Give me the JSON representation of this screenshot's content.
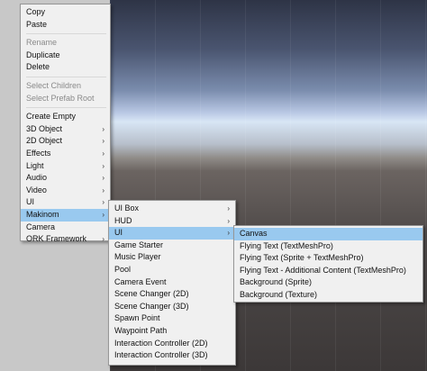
{
  "main_menu": {
    "copy": "Copy",
    "paste": "Paste",
    "rename": "Rename",
    "duplicate": "Duplicate",
    "delete": "Delete",
    "select_children": "Select Children",
    "select_prefab_root": "Select Prefab Root",
    "create_empty": "Create Empty",
    "object_3d": "3D Object",
    "object_2d": "2D Object",
    "effects": "Effects",
    "light": "Light",
    "audio": "Audio",
    "video": "Video",
    "ui": "UI",
    "makinom": "Makinom",
    "camera": "Camera",
    "ork_framework": "ORK Framework",
    "submenu_arrow": "›"
  },
  "makinom_menu": {
    "items": [
      "UI Box",
      "HUD",
      "UI",
      "Game Starter",
      "Music Player",
      "Pool",
      "Camera Event",
      "Scene Changer (2D)",
      "Scene Changer (3D)",
      "Spawn Point",
      "Waypoint Path",
      "Interaction Controller (2D)",
      "Interaction Controller (3D)"
    ]
  },
  "ui_menu": {
    "items": [
      "Canvas",
      "Flying Text (TextMeshPro)",
      "Flying Text (Sprite + TextMeshPro)",
      "Flying Text - Additional Content (TextMeshPro)",
      "Background (Sprite)",
      "Background (Texture)"
    ]
  },
  "colors": {
    "menu_background": "#f0f0f0",
    "highlight": "#99c9ef",
    "disabled_text": "#8a8a8a"
  }
}
